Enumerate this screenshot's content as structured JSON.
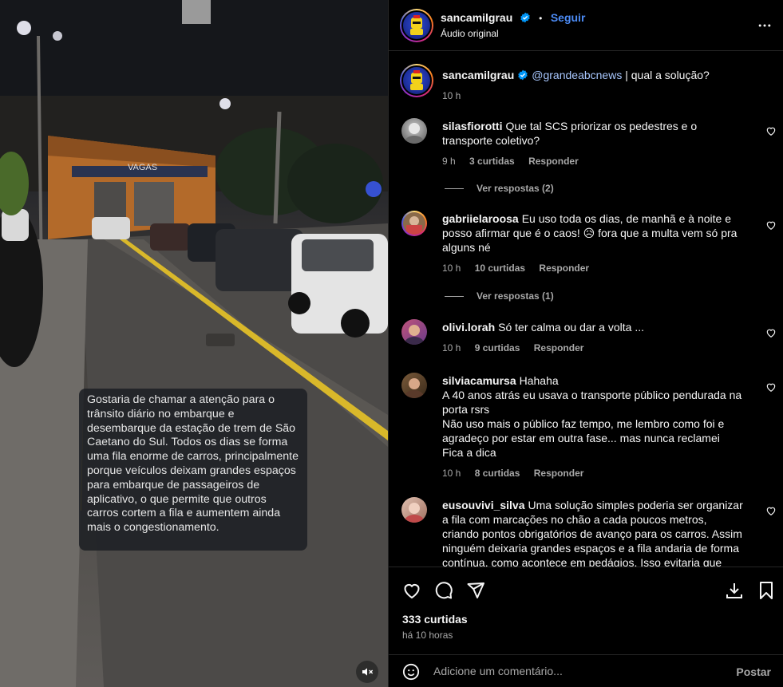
{
  "header": {
    "username": "sancamilgrau",
    "separator": "•",
    "follow_label": "Seguir",
    "audio_label": "Áudio original",
    "more_icon": "more-horizontal-icon"
  },
  "video": {
    "caption": "Gostaria de chamar a atenção para o trânsito diário no embarque e desembarque da estação de trem de São Caetano do Sul. Todos os dias se forma uma fila enorme de carros, principalmente porque veículos deixam grandes espaços para embarque de passageiros de aplicativo, o que permite que outros carros cortem a fila e aumentem ainda mais o congestionamento.",
    "sign_text": "VAGAS",
    "mute_icon": "volume-muted-icon"
  },
  "post": {
    "username": "sancamilgrau",
    "mention": "@grandeabcnews",
    "text": "| qual a solução?",
    "time": "10 h"
  },
  "comments": [
    {
      "username": "silasfiorotti",
      "text": "Que tal SCS priorizar os pedestres e o transporte coletivo?",
      "time": "9 h",
      "likes": "3 curtidas",
      "reply_label": "Responder",
      "view_replies": "Ver respostas (2)"
    },
    {
      "username": "gabriielaroosa",
      "text": "Eu uso toda os dias, de manhã e à noite e posso afirmar que é o caos! 😥 fora que a multa vem só pra alguns né",
      "time": "10 h",
      "likes": "10 curtidas",
      "reply_label": "Responder",
      "view_replies": "Ver respostas (1)"
    },
    {
      "username": "olivi.lorah",
      "text": "Só ter calma ou dar a volta ...",
      "time": "10 h",
      "likes": "9 curtidas",
      "reply_label": "Responder"
    },
    {
      "username": "silviacamursa",
      "lines": [
        "Hahaha",
        "A 40 anos atrás eu usava o transporte público pendurada na porta rsrs",
        "Não uso mais o público faz tempo, me lembro como foi e agradeço por estar em outra fase... mas nunca reclamei",
        "Fica a dica"
      ],
      "time": "10 h",
      "likes": "8 curtidas",
      "reply_label": "Responder"
    },
    {
      "username": "eusouvivi_silva",
      "text": "Uma solução simples poderia ser organizar a fila com marcações no chão a cada poucos metros, criando pontos obrigatórios de avanço para os carros. Assim ninguém deixaria grandes espaços e a fila andaria de forma contínua, como acontece em pedágios. Isso evitaria que veículos"
    }
  ],
  "actions": {
    "likes": "333 curtidas",
    "time_ago": "há 10 horas",
    "icons": [
      "heart-icon",
      "comment-icon",
      "share-icon",
      "download-icon",
      "bookmark-icon"
    ]
  },
  "composer": {
    "placeholder": "Adicione um comentário...",
    "post_label": "Postar",
    "emoji_icon": "emoji-icon"
  },
  "colors": {
    "link_blue": "#4c8bf5",
    "muted_text": "#a8a8a8",
    "background": "#000000",
    "caption_bg": "#1e2024"
  }
}
